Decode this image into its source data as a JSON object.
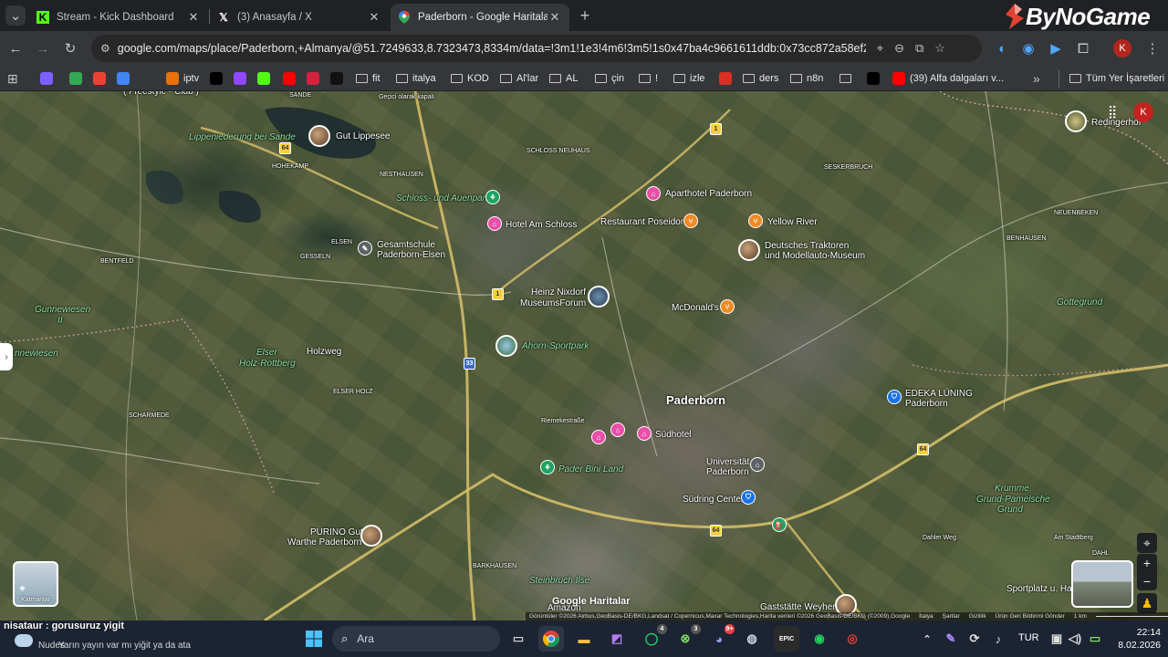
{
  "tabs": [
    {
      "title": "Stream - Kick Dashboard",
      "icon": "kick-icon",
      "active": false
    },
    {
      "title": "(3) Anasayfa / X",
      "icon": "x-icon",
      "active": false
    },
    {
      "title": "Paderborn - Google Haritalar",
      "icon": "google-maps-icon",
      "active": true
    }
  ],
  "toolbar": {
    "url": "google.com/maps/place/Paderborn,+Almanya/@51.7249633,8.7323473,8334m/data=!3m1!1e3!4m6!3m5!1s0x47ba4c9661611ddb:0x73cc872a58ef22ee!8m2!3...",
    "profile_initial": "K"
  },
  "watermark": "ByNoGame",
  "bookmarks": [
    {
      "label": "",
      "icon": "gemini-icon",
      "color": "#7b61ff"
    },
    {
      "label": "",
      "icon": "maps-icon",
      "color": "#34a853"
    },
    {
      "label": "",
      "icon": "gmail-icon",
      "color": "#ea4335"
    },
    {
      "label": "",
      "icon": "translate-icon",
      "color": "#4285f4"
    },
    {
      "label": "iptv",
      "icon": "iptv-icon",
      "color": "#e8710a"
    },
    {
      "label": "",
      "icon": "x-icon",
      "color": "#000000"
    },
    {
      "label": "",
      "icon": "twitch-icon",
      "color": "#9146ff"
    },
    {
      "label": "",
      "icon": "kick-icon",
      "color": "#53fc18"
    },
    {
      "label": "",
      "icon": "youtube-icon",
      "color": "#ff0000"
    },
    {
      "label": "",
      "icon": "u-icon",
      "color": "#d4213d"
    },
    {
      "label": "",
      "icon": "tv-icon",
      "color": "#111111"
    },
    {
      "label": "fit",
      "icon": "folder-icon",
      "color": ""
    },
    {
      "label": "italya",
      "icon": "folder-icon",
      "color": ""
    },
    {
      "label": "KOD",
      "icon": "folder-icon",
      "color": ""
    },
    {
      "label": "Al'lar",
      "icon": "folder-icon",
      "color": ""
    },
    {
      "label": "AL",
      "icon": "folder-icon",
      "color": ""
    },
    {
      "label": "çin",
      "icon": "folder-icon",
      "color": ""
    },
    {
      "label": "!",
      "icon": "folder-icon",
      "color": ""
    },
    {
      "label": "izle",
      "icon": "folder-icon",
      "color": ""
    },
    {
      "label": "",
      "icon": "pdf-icon",
      "color": "#d93025"
    },
    {
      "label": "ders",
      "icon": "folder-icon",
      "color": ""
    },
    {
      "label": "n8n",
      "icon": "folder-icon",
      "color": ""
    },
    {
      "label": "",
      "icon": "folder-icon",
      "color": ""
    },
    {
      "label": "",
      "icon": "x-icon",
      "color": "#000000"
    },
    {
      "label": "(39) Alfa dalgaları v...",
      "icon": "youtube-icon",
      "color": "#ff0000"
    }
  ],
  "all_bookmarks": "Tüm Yer İşaretleri",
  "map": {
    "labels": [
      {
        "t": "Gut Lippesee",
        "c": ""
      },
      {
        "t": "Lippeniederung bei Sande",
        "c": "green"
      },
      {
        "t": "HOHEKAMP",
        "c": "small"
      },
      {
        "t": "NESTHAUSEN",
        "c": "small"
      },
      {
        "t": "SANDE",
        "c": "small"
      },
      {
        "t": "Schloss- und Auenpark",
        "c": "green"
      },
      {
        "t": "SCHLOSS NEUHAUS",
        "c": "small"
      },
      {
        "t": "Hotel Am Schloss",
        "c": ""
      },
      {
        "t": "Aparthotel Paderborn",
        "c": ""
      },
      {
        "t": "Restaurant Poseidon",
        "c": ""
      },
      {
        "t": "Yellow River",
        "c": ""
      },
      {
        "t": "Deutsches Traktoren",
        "c": ""
      },
      {
        "t": "und Modellauto-Museum",
        "c": ""
      },
      {
        "t": "SESKERBRUCH",
        "c": "small"
      },
      {
        "t": "NEUENBEKEN",
        "c": "small"
      },
      {
        "t": "BENHAUSEN",
        "c": "small"
      },
      {
        "t": "Redingerhof",
        "c": ""
      },
      {
        "t": "Gesamtschule",
        "c": ""
      },
      {
        "t": "Paderborn-Elsen",
        "c": ""
      },
      {
        "t": "ELSEN",
        "c": "small"
      },
      {
        "t": "GESSELN",
        "c": "small"
      },
      {
        "t": "BENTFELD",
        "c": "small"
      },
      {
        "t": "Gunnewiesen",
        "c": "green"
      },
      {
        "t": "II",
        "c": "green"
      },
      {
        "t": "Heinz Nixdorf",
        "c": ""
      },
      {
        "t": "MuseumsForum",
        "c": ""
      },
      {
        "t": "McDonald's",
        "c": ""
      },
      {
        "t": "Gottegrund",
        "c": "green"
      },
      {
        "t": "Ahorn-Sportpark",
        "c": "green"
      },
      {
        "t": "Elser",
        "c": "green"
      },
      {
        "t": "Holz-Rottberg",
        "c": "green"
      },
      {
        "t": "ELSER HOLZ",
        "c": "small"
      },
      {
        "t": "Holzweg",
        "c": ""
      },
      {
        "t": "nnewiesen",
        "c": "green"
      },
      {
        "t": "Paderborn",
        "c": "city"
      },
      {
        "t": "EDEKA LÜNING",
        "c": ""
      },
      {
        "t": "Paderborn",
        "c": ""
      },
      {
        "t": "SCHARMEDE",
        "c": "small"
      },
      {
        "t": "Riemekestraße",
        "c": "small"
      },
      {
        "t": "Südhotel",
        "c": ""
      },
      {
        "t": "Pader Bini Land",
        "c": "green"
      },
      {
        "t": "Universität",
        "c": ""
      },
      {
        "t": "Paderborn",
        "c": ""
      },
      {
        "t": "Südring Center",
        "c": ""
      },
      {
        "t": "Krumme",
        "c": "green"
      },
      {
        "t": "Grund-Pamelsche",
        "c": "green"
      },
      {
        "t": "Grund",
        "c": "green"
      },
      {
        "t": "PURINO Gut",
        "c": ""
      },
      {
        "t": "Warthe Paderborn",
        "c": ""
      },
      {
        "t": "BARKHAUSEN",
        "c": "small"
      },
      {
        "t": "Steinbruch Ilse",
        "c": "green"
      },
      {
        "t": "Amazon",
        "c": ""
      },
      {
        "t": "Dahler Weg",
        "c": "small"
      },
      {
        "t": "Am Stadtberg",
        "c": "small"
      },
      {
        "t": "DAHL",
        "c": "small"
      },
      {
        "t": "Sportplatz u. Halle",
        "c": ""
      },
      {
        "t": "Gaststätte Weyher",
        "c": ""
      },
      {
        "t": "Geçici olarak kapalı",
        "c": "small"
      },
      {
        "t": "( Freestyle - Club )",
        "c": ""
      }
    ],
    "layers_label": "Katmanlar",
    "google_logo": "Google Haritalar",
    "attribution": "Görüntüler ©2026 Airbus,GeoBasis-DE/BKG,Landsat / Copernicus,Maxar Technologies,Harita verileri ©2026 GeoBasis-DE/BKG (©2009),Google",
    "attribution_links": [
      "İtalya",
      "Şartlar",
      "Gizlilik",
      "Ürün Geri Bildirimi Gönder"
    ],
    "scale": "1 km",
    "road_numbers": [
      "64",
      "1",
      "33",
      "64",
      "1",
      "64"
    ],
    "avatar_initial": "K"
  },
  "chat": {
    "user": "nisataur",
    "message": ": gorusuruz yigit",
    "message2": "Yarın yayın var mı yiğit ya da ata",
    "news": "Nudes"
  },
  "taskbar": {
    "search_placeholder": "Ara",
    "language": "TUR",
    "time": "22:14",
    "date": "8.02.2026",
    "badges": {
      "whatsapp": "4",
      "xbox": "3",
      "discord": "9+"
    }
  },
  "colors": {
    "accent_red": "#e34133",
    "maps_blue": "#1a73e8",
    "poi_pink": "#e84fa8",
    "poi_orange": "#f08a24",
    "poi_green": "#1ea362"
  }
}
